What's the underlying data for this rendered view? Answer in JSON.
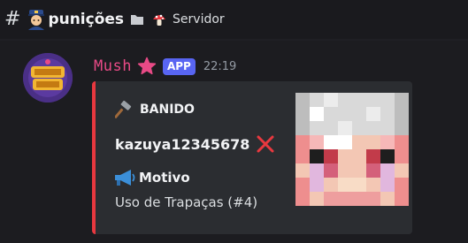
{
  "header": {
    "hash_symbol": "#",
    "channel_name": "punições",
    "server_name": "Servidor"
  },
  "message": {
    "author": "Mush",
    "badge": "APP",
    "timestamp": "22:19",
    "author_color": "#e84a86",
    "embed": {
      "accent_color": "#e8383f",
      "title": "BANIDO",
      "username": "kazuya12345678",
      "field_name": "Motivo",
      "field_value": "Uso de Trapaças (#4)"
    }
  }
}
